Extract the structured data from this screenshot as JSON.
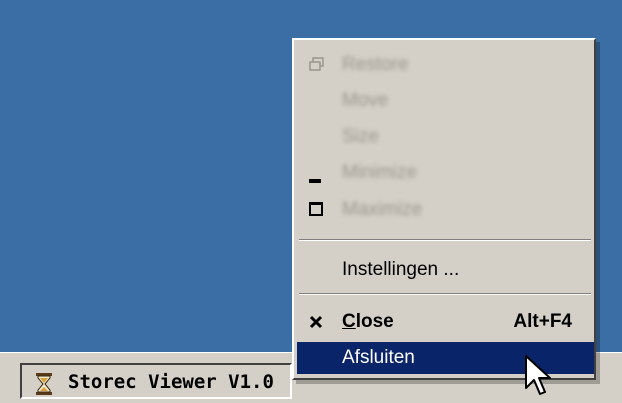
{
  "taskbar": {
    "task_label": "Storec Viewer V1.0",
    "task_icon": "hourglass-icon"
  },
  "menu": {
    "items": [
      {
        "label": "Restore",
        "icon": "restore-icon",
        "enabled": false
      },
      {
        "label": "Move",
        "enabled": false
      },
      {
        "label": "Size",
        "enabled": false
      },
      {
        "label": "Minimize",
        "icon": "minimize-icon",
        "enabled": false
      },
      {
        "label": "Maximize",
        "icon": "maximize-icon",
        "enabled": false
      },
      {
        "label": "Instellingen ...",
        "enabled": true
      },
      {
        "label_mnemonic": "C",
        "label_rest": "lose",
        "icon": "close-icon",
        "shortcut": "Alt+F4",
        "enabled": true,
        "bold": true
      },
      {
        "label": "Afsluiten",
        "enabled": true,
        "highlighted": true
      }
    ]
  },
  "colors": {
    "desktop": "#3a6ea5",
    "menu_bg": "#d4d0c8",
    "highlight": "#0a246a",
    "disabled_text": "#9a968e"
  }
}
